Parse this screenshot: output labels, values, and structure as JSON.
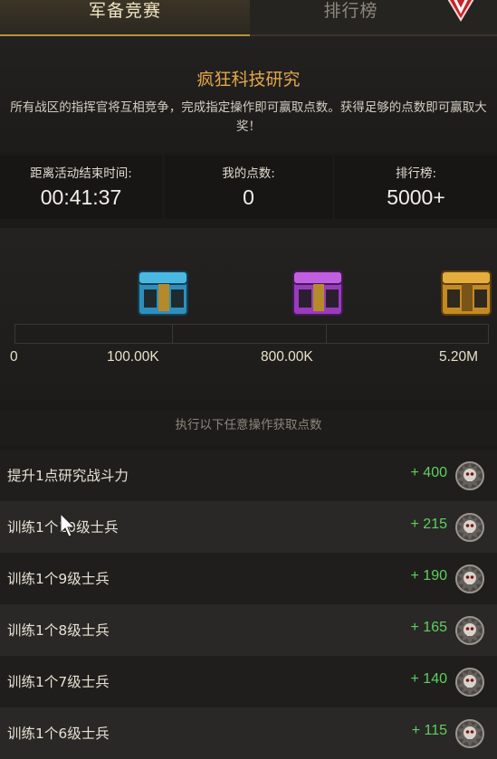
{
  "tabs": [
    {
      "label": "军备竞赛",
      "active": true
    },
    {
      "label": "排行榜",
      "active": false
    }
  ],
  "event": {
    "title": "疯狂科技研究",
    "description": "所有战区的指挥官将互相竞争，完成指定操作即可赢取点数。获得足够的点数即可赢取大奖！"
  },
  "stats": {
    "time_label": "距离活动结束时间:",
    "time_value": "00:41:37",
    "points_label": "我的点数:",
    "points_value": "0",
    "rank_label": "排行榜:",
    "rank_value": "5000+"
  },
  "rewards": {
    "progress": 0,
    "milestones": [
      "0",
      "100.00K",
      "800.00K",
      "5.20M"
    ],
    "chests": [
      {
        "icon": "blue-chest-icon",
        "color": "#3aa7d6"
      },
      {
        "icon": "purple-chest-icon",
        "color": "#b04fd0"
      },
      {
        "icon": "gold-chest-icon",
        "color": "#d69a2a"
      }
    ]
  },
  "tasks": {
    "header": "执行以下任意操作获取点数",
    "items": [
      {
        "name": "提升1点研究战斗力",
        "points": "+ 400"
      },
      {
        "name": "训练1个10级士兵",
        "points": "+ 215"
      },
      {
        "name": "训练1个9级士兵",
        "points": "+ 190"
      },
      {
        "name": "训练1个8级士兵",
        "points": "+ 165"
      },
      {
        "name": "训练1个7级士兵",
        "points": "+ 140"
      },
      {
        "name": "训练1个6级士兵",
        "points": "+ 115"
      }
    ]
  },
  "colors": {
    "accent_gold": "#e3a84a",
    "points_green": "#5fd05f",
    "tab_border": "#b8923c"
  }
}
